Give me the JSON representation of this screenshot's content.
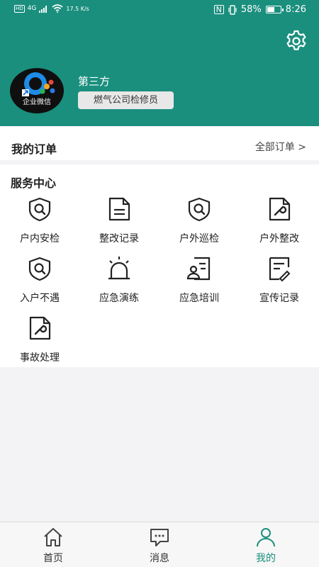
{
  "status_bar": {
    "network": "4G",
    "speed": "17.5 K/s",
    "battery": "58%",
    "time": "8:26"
  },
  "profile": {
    "avatar_caption": "企业微信",
    "name": "第三方",
    "role": "燃气公司检修员"
  },
  "orders": {
    "title": "我的订单",
    "all_label": "全部订单 >"
  },
  "services": {
    "title": "服务中心",
    "items": [
      {
        "label": "户内安检",
        "icon": "shield-search-icon"
      },
      {
        "label": "整改记录",
        "icon": "document-icon"
      },
      {
        "label": "户外巡检",
        "icon": "shield-search-icon"
      },
      {
        "label": "户外整改",
        "icon": "wrench-document-icon"
      },
      {
        "label": "入户不遇",
        "icon": "shield-search-icon"
      },
      {
        "label": "应急演练",
        "icon": "alarm-light-icon"
      },
      {
        "label": "应急培训",
        "icon": "person-document-icon"
      },
      {
        "label": "宣传记录",
        "icon": "edit-document-icon"
      },
      {
        "label": "事故处理",
        "icon": "wrench-document-icon"
      }
    ]
  },
  "tabbar": {
    "items": [
      {
        "label": "首页",
        "icon": "home-icon"
      },
      {
        "label": "消息",
        "icon": "message-icon"
      },
      {
        "label": "我的",
        "icon": "profile-icon"
      }
    ]
  },
  "colors": {
    "brand": "#1b8f7e",
    "background": "#f3f3f5"
  }
}
